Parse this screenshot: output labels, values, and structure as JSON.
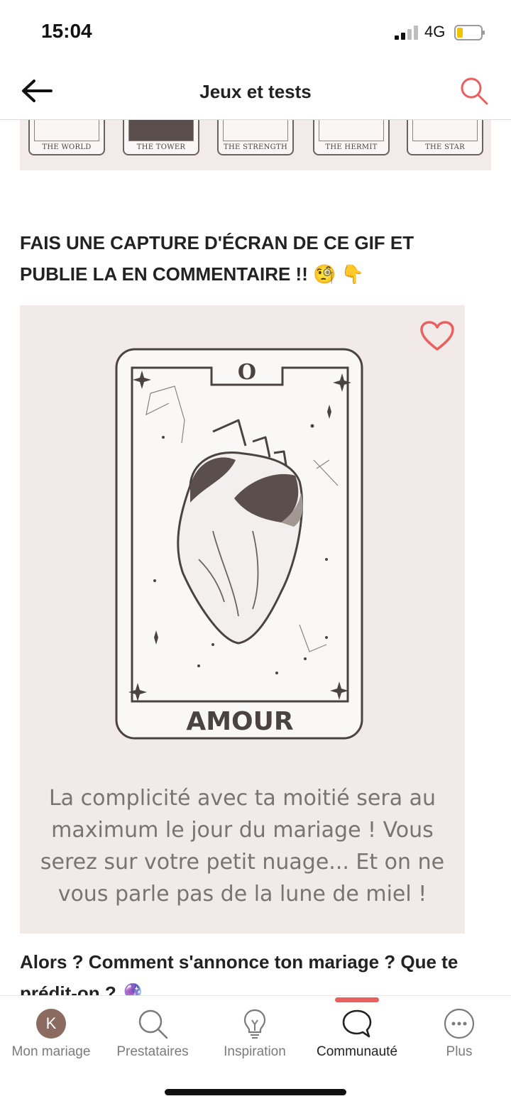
{
  "status_bar": {
    "time": "15:04",
    "network": "4G"
  },
  "header": {
    "title": "Jeux et tests"
  },
  "tarot_strip": {
    "cards": [
      "THE WORLD",
      "THE TOWER",
      "THE STRENGTH",
      "THE HERMIT",
      "THE STAR"
    ]
  },
  "post": {
    "intro": "FAIS UNE CAPTURE D'ÉCRAN DE CE GIF ET PUBLIE LA EN COMMENTAIRE !! 🧐 👇",
    "card": {
      "number": "O",
      "title": "AMOUR",
      "caption": "La complicité avec ta moitié sera au maximum le jour du mariage ! Vous serez sur votre petit nuage... Et on ne vous parle pas de la lune de miel !"
    },
    "question": "Alors ? Comment s'annonce ton mariage ? Que te prédit-on ? 🔮"
  },
  "bottom_nav": {
    "items": [
      {
        "label": "Mon mariage",
        "avatar_letter": "K"
      },
      {
        "label": "Prestataires",
        "icon": "search-icon"
      },
      {
        "label": "Inspiration",
        "icon": "lightbulb-icon"
      },
      {
        "label": "Communauté",
        "icon": "chat-bubble-icon",
        "active": true
      },
      {
        "label": "Plus",
        "icon": "more-icon"
      }
    ]
  },
  "colors": {
    "accent": "#e8615e",
    "panel": "#f2eae8",
    "card_ink": "#4a4341",
    "avatar": "#8b6a60"
  }
}
